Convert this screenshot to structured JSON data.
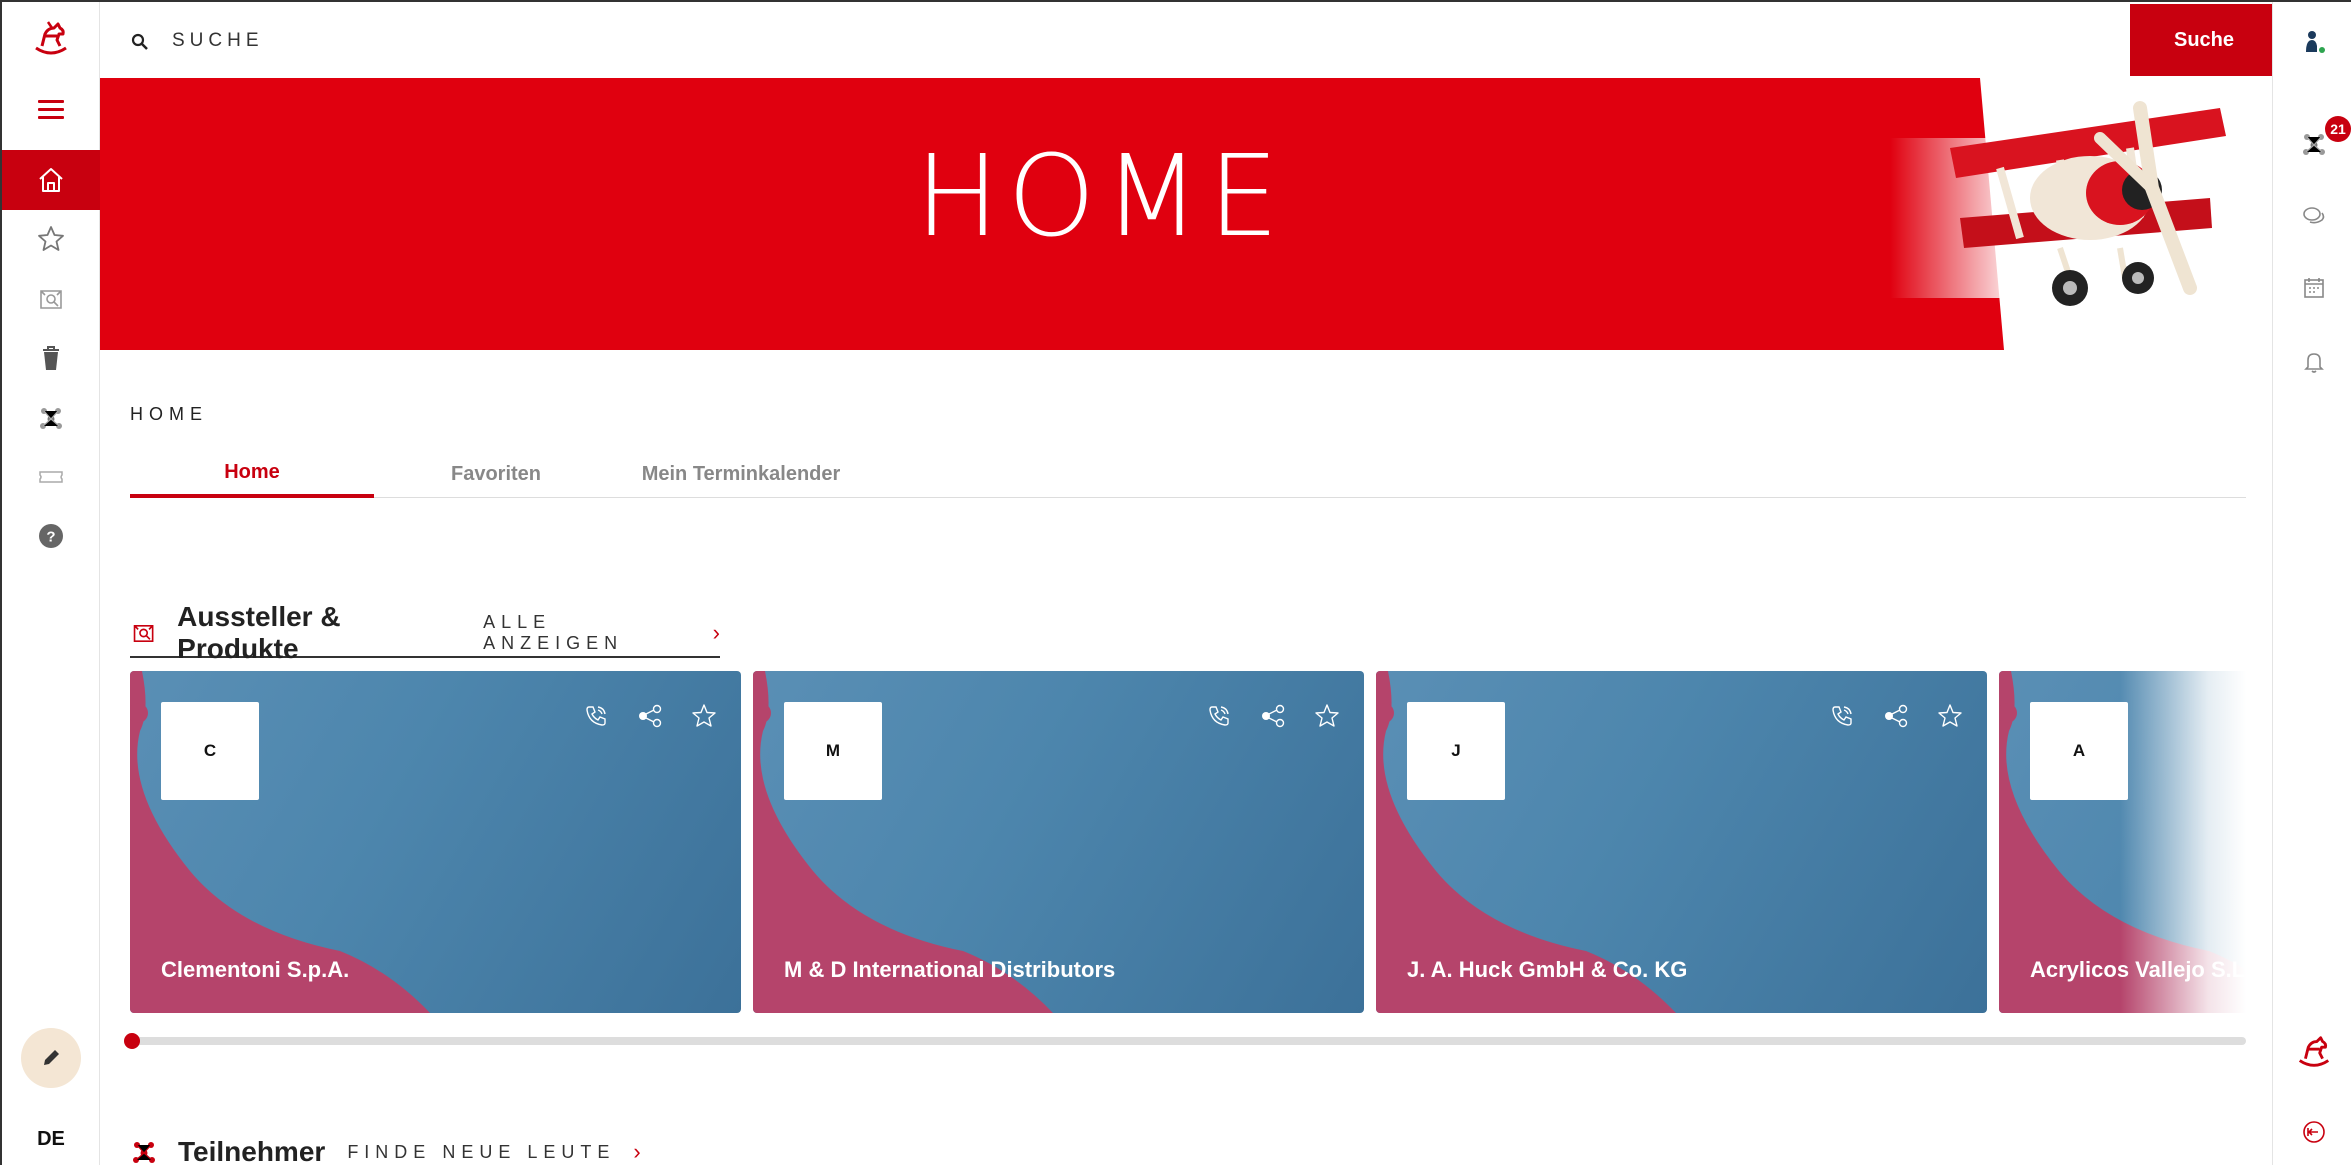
{
  "search": {
    "placeholder": "SUCHE",
    "button_label": "Suche"
  },
  "hero": {
    "title": "HOME"
  },
  "breadcrumb": "HOME",
  "tabs": [
    {
      "label": "Home",
      "active": true
    },
    {
      "label": "Favoriten",
      "active": false
    },
    {
      "label": "Mein Terminkalender",
      "active": false
    }
  ],
  "sections": {
    "exhibitors": {
      "title": "Aussteller & Produkte",
      "link": "ALLE ANZEIGEN"
    },
    "participants": {
      "title": "Teilnehmer",
      "link": "FINDE NEUE LEUTE"
    }
  },
  "cards": [
    {
      "initial": "C",
      "name": "Clementoni S.p.A."
    },
    {
      "initial": "M",
      "name": "M & D International Distributors"
    },
    {
      "initial": "J",
      "name": "J. A. Huck GmbH & Co. KG"
    },
    {
      "initial": "A",
      "name": "Acrylicos Vallejo S.L."
    }
  ],
  "leftbar": {
    "items": [
      "home-icon",
      "star-icon",
      "exhibitor-icon",
      "trash-icon",
      "network-icon",
      "ticket-icon",
      "help-icon"
    ],
    "language": "DE"
  },
  "rightbar": {
    "notification_count": "21"
  },
  "colors": {
    "brand_red": "#c8000f",
    "card_blue": "#4d86ad",
    "card_pink": "#b5446b"
  }
}
